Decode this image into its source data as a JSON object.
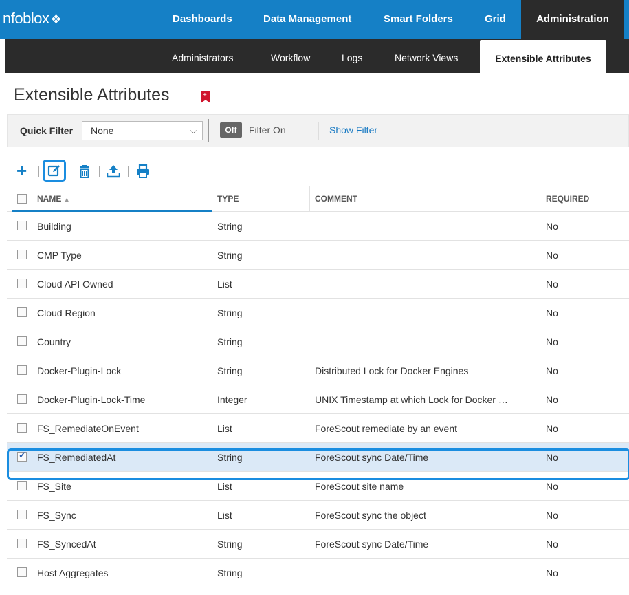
{
  "app": {
    "logo": "nfoblox",
    "logo_mark": "❖"
  },
  "topnav": {
    "tabs": [
      {
        "label": "Dashboards"
      },
      {
        "label": "Data Management"
      },
      {
        "label": "Smart Folders"
      },
      {
        "label": "Grid"
      },
      {
        "label": "Administration"
      }
    ],
    "active": "Administration"
  },
  "subnav": {
    "tabs": [
      {
        "label": "Administrators"
      },
      {
        "label": "Workflow"
      },
      {
        "label": "Logs"
      },
      {
        "label": "Network Views"
      },
      {
        "label": "Extensible Attributes"
      }
    ],
    "active": "Extensible Attributes"
  },
  "page": {
    "title": "Extensible Attributes"
  },
  "filter": {
    "quick_filter_label": "Quick Filter",
    "quick_filter_value": "None",
    "toggle_label": "Off",
    "filter_on_label": "Filter On",
    "show_filter_label": "Show Filter"
  },
  "toolbar": {
    "icons": [
      "add-icon",
      "edit-icon",
      "delete-icon",
      "export-icon",
      "print-icon"
    ]
  },
  "table": {
    "columns": [
      "NAME",
      "TYPE",
      "COMMENT",
      "REQUIRED"
    ],
    "sort_column": "NAME",
    "sort_indicator": "▲",
    "rows": [
      {
        "name": "Building",
        "type": "String",
        "comment": "",
        "required": "No",
        "checked": false
      },
      {
        "name": "CMP Type",
        "type": "String",
        "comment": "",
        "required": "No",
        "checked": false
      },
      {
        "name": "Cloud API Owned",
        "type": "List",
        "comment": "",
        "required": "No",
        "checked": false
      },
      {
        "name": "Cloud Region",
        "type": "String",
        "comment": "",
        "required": "No",
        "checked": false
      },
      {
        "name": "Country",
        "type": "String",
        "comment": "",
        "required": "No",
        "checked": false
      },
      {
        "name": "Docker-Plugin-Lock",
        "type": "String",
        "comment": "Distributed Lock for Docker Engines",
        "required": "No",
        "checked": false
      },
      {
        "name": "Docker-Plugin-Lock-Time",
        "type": "Integer",
        "comment": "UNIX Timestamp at which Lock for Docker …",
        "required": "No",
        "checked": false
      },
      {
        "name": "FS_RemediateOnEvent",
        "type": "List",
        "comment": "ForeScout remediate by an event",
        "required": "No",
        "checked": false
      },
      {
        "name": "FS_RemediatedAt",
        "type": "String",
        "comment": "ForeScout sync Date/Time",
        "required": "No",
        "checked": true
      },
      {
        "name": "FS_Site",
        "type": "List",
        "comment": "ForeScout site name",
        "required": "No",
        "checked": false
      },
      {
        "name": "FS_Sync",
        "type": "List",
        "comment": "ForeScout sync the object",
        "required": "No",
        "checked": false
      },
      {
        "name": "FS_SyncedAt",
        "type": "String",
        "comment": "ForeScout sync Date/Time",
        "required": "No",
        "checked": false
      },
      {
        "name": "Host Aggregates",
        "type": "String",
        "comment": "",
        "required": "No",
        "checked": false
      }
    ]
  },
  "colors": {
    "primary": "#1580c6",
    "dark_nav": "#2b2b2b",
    "highlight": "#1a8de0",
    "selected_row": "#dbe9f7",
    "bookmark": "#d0152d"
  }
}
